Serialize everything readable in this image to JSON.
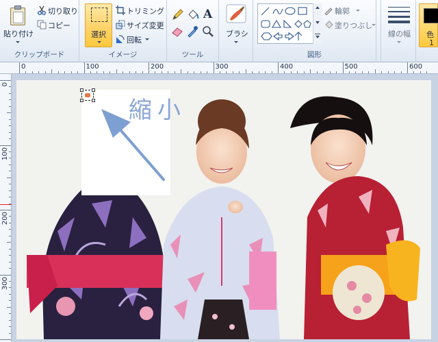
{
  "ribbon": {
    "clipboard": {
      "paste_label": "貼り付け",
      "cut_label": "切り取り",
      "copy_label": "コピー",
      "group_label": "クリップボード"
    },
    "image": {
      "select_label": "選択",
      "crop_label": "トリミング",
      "resize_label": "サイズ変更",
      "rotate_label": "回転",
      "group_label": "イメージ"
    },
    "tools": {
      "group_label": "ツール",
      "text_tool_glyph": "A"
    },
    "brushes": {
      "label": "ブラシ"
    },
    "shapes": {
      "outline_label": "輪郭",
      "fill_label": "塗りつぶし",
      "group_label": "図形"
    },
    "size": {
      "label": "線の幅"
    },
    "colors": {
      "color1_label": "色",
      "color1_number": "1"
    }
  },
  "ruler": {
    "horizontal_labels": [
      "0",
      "100",
      "200",
      "300",
      "400",
      "500",
      "600"
    ],
    "vertical_labels": [
      "0",
      "100",
      "200",
      "300"
    ]
  },
  "canvas": {
    "annotation_text": "縮小",
    "colors": {
      "annotation": "#8aa6d4",
      "arrow": "#7e9fd1",
      "selection": "#ffffff"
    }
  }
}
